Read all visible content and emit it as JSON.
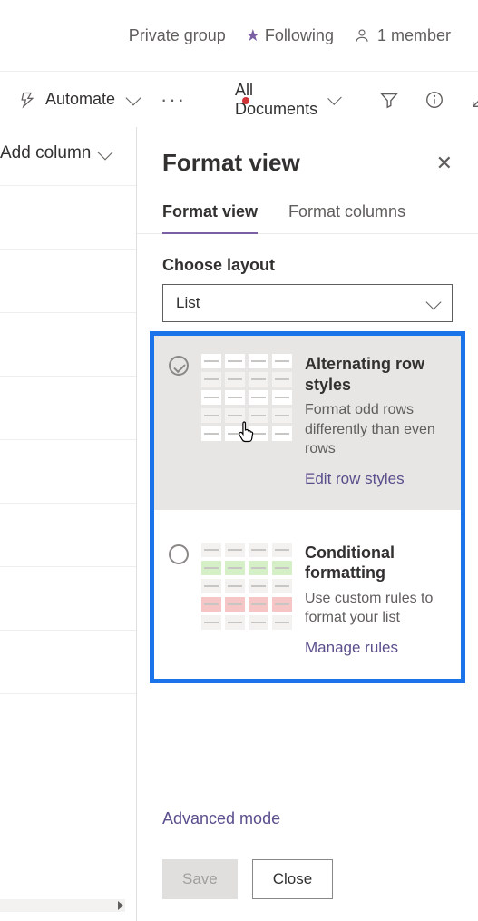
{
  "header": {
    "group_type": "Private group",
    "following": "Following",
    "members": "1 member"
  },
  "toolbar": {
    "automate": "Automate",
    "views_label": "All Documents"
  },
  "addColumn": {
    "label": "Add column"
  },
  "panel": {
    "title": "Format view",
    "tabs": {
      "view": "Format view",
      "columns": "Format columns"
    },
    "layout_label": "Choose layout",
    "layout_value": "List",
    "cards": {
      "alt": {
        "title": "Alternating row styles",
        "desc": "Format odd rows differently than even rows",
        "link": "Edit row styles"
      },
      "cond": {
        "title": "Conditional formatting",
        "desc": "Use custom rules to format your list",
        "link": "Manage rules"
      }
    },
    "advanced": "Advanced mode",
    "save": "Save",
    "close": "Close"
  }
}
